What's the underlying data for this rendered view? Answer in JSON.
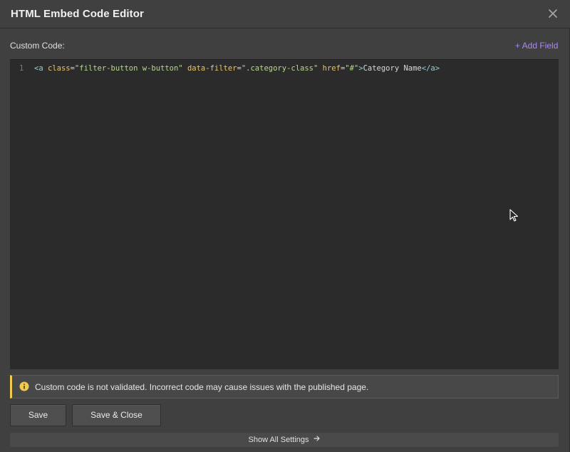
{
  "dialog": {
    "title": "HTML Embed Code Editor"
  },
  "icons": {
    "close": "close-icon",
    "info": "info-icon",
    "arrow": "arrow-right-icon",
    "cursor": "mouse-pointer-icon"
  },
  "colors": {
    "accent": "#a98af2",
    "warning": "#f2c94c"
  },
  "editor": {
    "label": "Custom Code:",
    "add_field": "+ Add Field",
    "line_number": "1",
    "tokens": {
      "t1": "<a",
      "t2": " ",
      "t3": "class",
      "t4": "=",
      "t5": "\"filter-button w-button\"",
      "t6": " ",
      "t7": "data-filter",
      "t8": "=",
      "t9": "\".category-class\"",
      "t10": " ",
      "t11": "href",
      "t12": "=",
      "t13": "\"#\"",
      "t14": ">",
      "t15": "Category Name",
      "t16": "</a>"
    }
  },
  "warning": {
    "text": "Custom code is not validated. Incorrect code may cause issues with the published page."
  },
  "buttons": {
    "save": "Save",
    "save_close": "Save & Close"
  },
  "footer": {
    "show_settings": "Show All Settings"
  }
}
